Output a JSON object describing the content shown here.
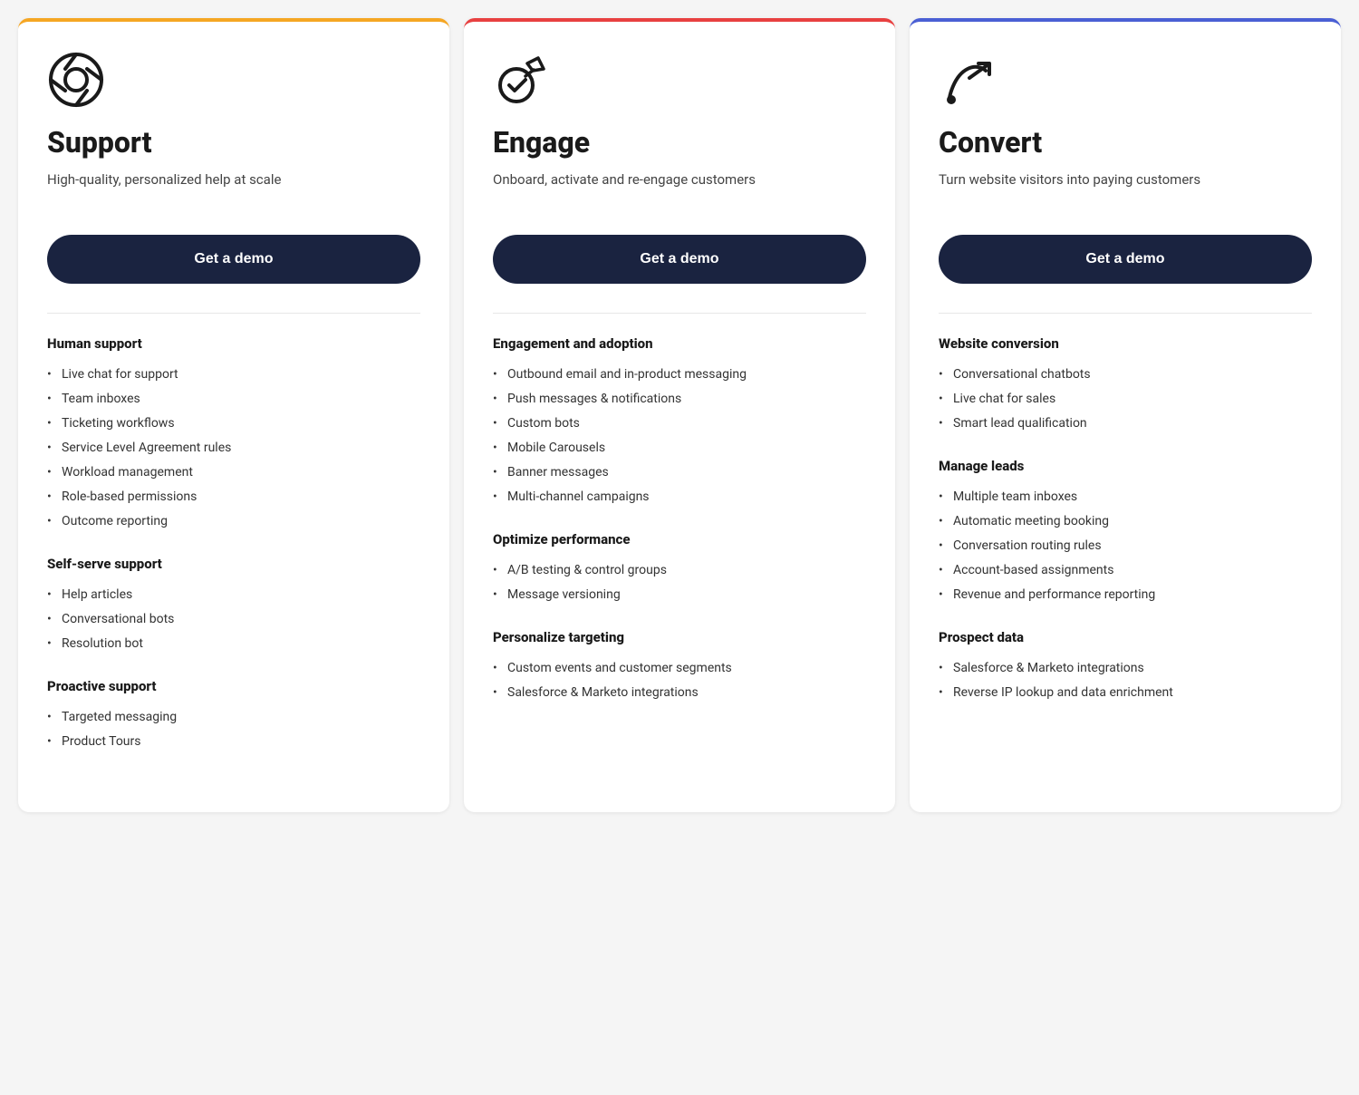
{
  "cards": [
    {
      "id": "support",
      "accent_color": "#f5a623",
      "icon": "support",
      "title": "Support",
      "subtitle": "High-quality, personalized help at scale",
      "cta_label": "Get a demo",
      "sections": [
        {
          "title": "Human support",
          "items": [
            "Live chat for support",
            "Team inboxes",
            "Ticketing workflows",
            "Service Level Agreement rules",
            "Workload management",
            "Role-based permissions",
            "Outcome reporting"
          ]
        },
        {
          "title": "Self-serve support",
          "items": [
            "Help articles",
            "Conversational bots",
            "Resolution bot"
          ]
        },
        {
          "title": "Proactive support",
          "items": [
            "Targeted messaging",
            "Product Tours"
          ]
        }
      ]
    },
    {
      "id": "engage",
      "accent_color": "#e84040",
      "icon": "engage",
      "title": "Engage",
      "subtitle": "Onboard, activate and re-engage customers",
      "cta_label": "Get a demo",
      "sections": [
        {
          "title": "Engagement and adoption",
          "items": [
            "Outbound email and in-product messaging",
            "Push messages & notifications",
            "Custom bots",
            "Mobile Carousels",
            "Banner messages",
            "Multi-channel campaigns"
          ]
        },
        {
          "title": "Optimize performance",
          "items": [
            "A/B testing & control groups",
            "Message versioning"
          ]
        },
        {
          "title": "Personalize targeting",
          "items": [
            "Custom events and customer segments",
            "Salesforce & Marketo integrations"
          ]
        }
      ]
    },
    {
      "id": "convert",
      "accent_color": "#4a5fd4",
      "icon": "convert",
      "title": "Convert",
      "subtitle": "Turn website visitors into paying customers",
      "cta_label": "Get a demo",
      "sections": [
        {
          "title": "Website conversion",
          "items": [
            "Conversational chatbots",
            "Live chat for sales",
            "Smart lead qualification"
          ]
        },
        {
          "title": "Manage leads",
          "items": [
            "Multiple team inboxes",
            "Automatic meeting booking",
            "Conversation routing rules",
            "Account-based assignments",
            "Revenue and performance reporting"
          ]
        },
        {
          "title": "Prospect data",
          "items": [
            "Salesforce & Marketo integrations",
            "Reverse IP lookup and data enrichment"
          ]
        }
      ]
    }
  ]
}
